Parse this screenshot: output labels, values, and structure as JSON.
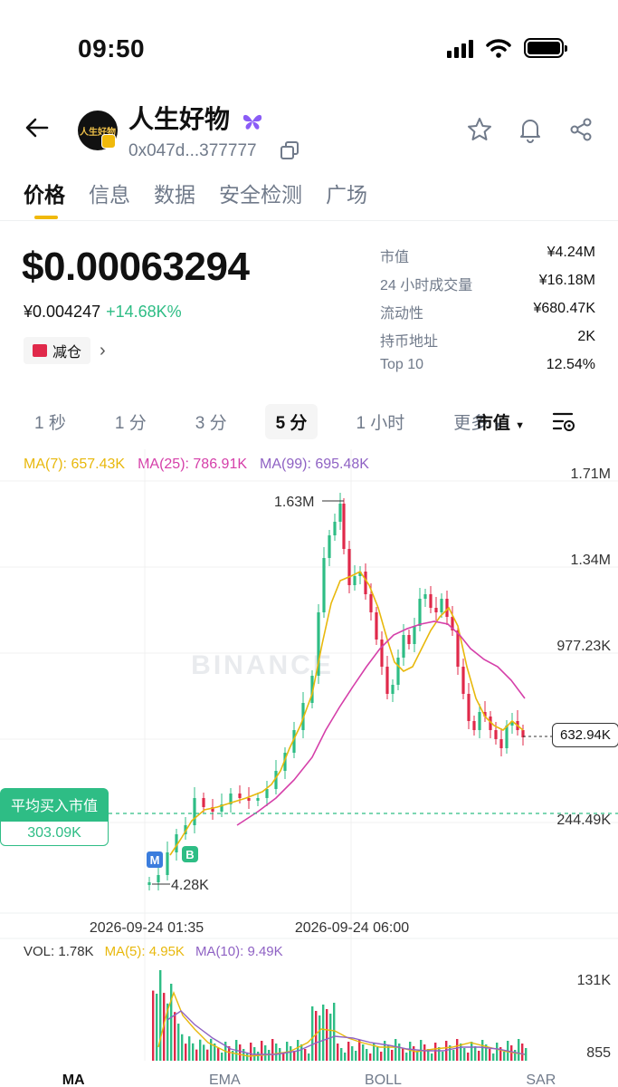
{
  "status": {
    "time": "09:50"
  },
  "token": {
    "name": "人生好物",
    "address": "0x047d...377777",
    "avatar_text": "人生好物"
  },
  "tabs": [
    {
      "label": "价格",
      "active": true
    },
    {
      "label": "信息"
    },
    {
      "label": "数据"
    },
    {
      "label": "安全检测"
    },
    {
      "label": "广场"
    }
  ],
  "price": {
    "usd": "$0.00063294",
    "cny": "¥0.004247",
    "change": "+14.68K%"
  },
  "reduce": {
    "label": "减仓"
  },
  "stats": [
    {
      "k": "市值",
      "v": "¥4.24M"
    },
    {
      "k": "24 小时成交量",
      "v": "¥16.18M"
    },
    {
      "k": "流动性",
      "v": "¥680.47K"
    },
    {
      "k": "持币地址",
      "v": "2K"
    },
    {
      "k": "Top 10",
      "v": "12.54%"
    }
  ],
  "intervals": [
    "1 秒",
    "1 分",
    "3 分",
    "5 分",
    "1 小时"
  ],
  "selected_interval": "5 分",
  "more_label": "更多",
  "metric_label": "市值",
  "ma_legend": {
    "ma7": "MA(7): 657.43K",
    "ma25": "MA(25): 786.91K",
    "ma99": "MA(99): 695.48K"
  },
  "y_axis": [
    "1.71M",
    "1.34M",
    "977.23K",
    "244.49K"
  ],
  "x_axis": [
    "2026-09-24 01:35",
    "2026-09-24 06:00"
  ],
  "annotations": {
    "high": "1.63M",
    "low": "4.28K",
    "current": "632.94K"
  },
  "avg_buy": {
    "label": "平均买入市值",
    "value": "303.09K"
  },
  "markers": {
    "m": "M",
    "b": "B"
  },
  "watermark": "BINANCE",
  "vol_legend": {
    "vol": "VOL: 1.78K",
    "ma5": "MA(5): 4.95K",
    "ma10": "MA(10): 9.49K"
  },
  "vol_axis": [
    "131K",
    "855"
  ],
  "bottom_tabs": [
    "MA",
    "EMA",
    "BOLL",
    "SAR"
  ],
  "colors": {
    "up": "#2ebd85",
    "down": "#e0294a",
    "accent": "#f0b90b"
  }
}
